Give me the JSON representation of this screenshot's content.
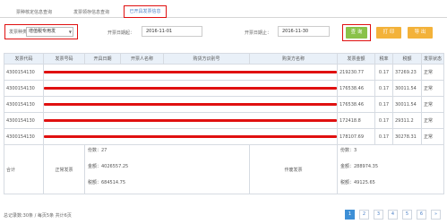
{
  "tabs": [
    {
      "label": "票种核定信息查询"
    },
    {
      "label": "发票领存信息查询"
    },
    {
      "label": "已开具发票信息"
    }
  ],
  "filters": {
    "invoice_type_label": "发票种类：",
    "invoice_type_value": "增值税专用发",
    "start_label": "开票日期起：",
    "start_value": "2016-11-01",
    "end_label": "开票日期止：",
    "end_value": "2016-11-30"
  },
  "buttons": {
    "search": "查 询",
    "print": "打 印",
    "export": "导 出"
  },
  "table": {
    "headers": [
      "发票代码",
      "发票号码",
      "开具日期",
      "开票人名称",
      "购货方识别号",
      "购货方名称",
      "发票金额",
      "税率",
      "税额",
      "发票状态"
    ],
    "rows": [
      {
        "code": "4300154130",
        "amount": "219230.77",
        "rate": "0.17",
        "tax": "37269.23",
        "status": "正常"
      },
      {
        "code": "4300154130",
        "amount": "176538.46",
        "rate": "0.17",
        "tax": "30011.54",
        "status": "正常"
      },
      {
        "code": "4300154130",
        "amount": "176538.46",
        "rate": "0.17",
        "tax": "30011.54",
        "status": "正常"
      },
      {
        "code": "4300154130",
        "amount": "172418.8",
        "rate": "0.17",
        "tax": "29311.2",
        "status": "正常"
      },
      {
        "code": "4300154130",
        "amount": "178107.69",
        "rate": "0.17",
        "tax": "30278.31",
        "status": "正常"
      }
    ],
    "summary": {
      "label": "合计",
      "normal_label": "正常发票",
      "normal_count": "份数：27",
      "normal_amount": "金额：4026557.25",
      "normal_tax": "税额：684514.75",
      "void_label": "作废发票",
      "void_count": "份数：3",
      "void_amount": "金额：288974.35",
      "void_tax": "税额：49125.65"
    }
  },
  "footer": {
    "total_text": "总记录数:30条 / 每页5条 共计6页"
  },
  "pager": {
    "pages": [
      "1",
      "2",
      "3",
      "4",
      "5",
      "6",
      "»"
    ]
  }
}
